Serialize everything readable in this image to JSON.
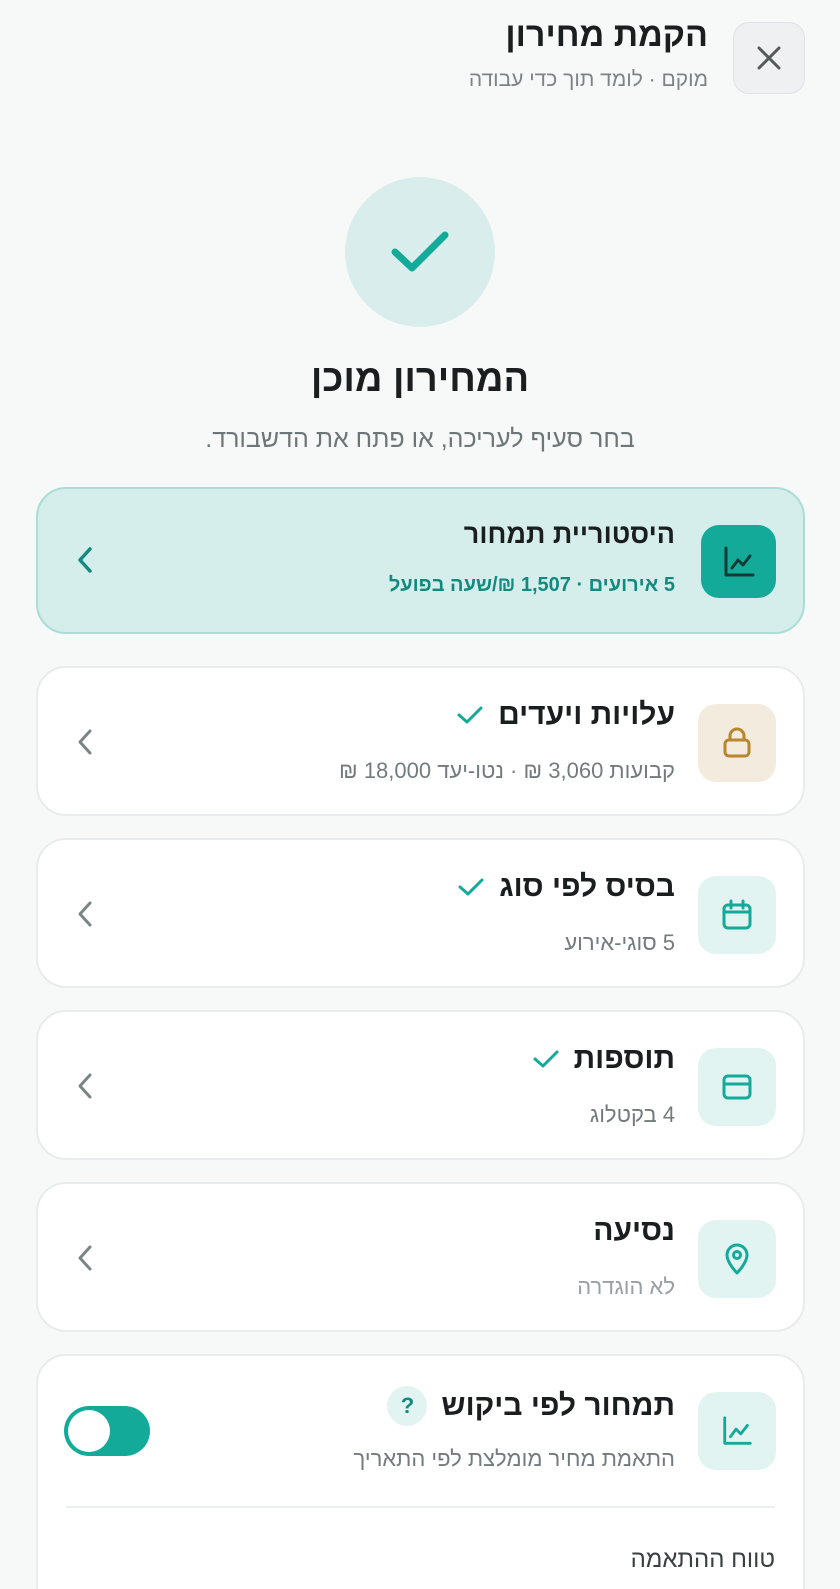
{
  "header": {
    "title": "הקמת מחירון",
    "subtitle": "מוקם · לומד תוך כדי עבודה",
    "close_icon": "close-icon"
  },
  "success": {
    "icon": "check-icon",
    "title": "המחירון מוכן",
    "subtitle": "בחר סעיף לעריכה, או פתח את הדשבורד."
  },
  "sections": [
    {
      "title": "היסטוריית תמחור",
      "subtitle": "5 אירועים · 1,507 ₪/שעה בפועל",
      "icon": "chart-icon",
      "active": true,
      "done": false
    },
    {
      "title": "עלויות ויעדים",
      "subtitle": "קבועות 3,060 ₪ · נטו-יעד 18,000 ₪",
      "icon": "lock-icon",
      "active": false,
      "done": true
    },
    {
      "title": "בסיס לפי סוג",
      "subtitle": "5 סוגי-אירוע",
      "icon": "calendar-icon",
      "active": false,
      "done": true
    },
    {
      "title": "תוספות",
      "subtitle": "4 בקטלוג",
      "icon": "card-icon",
      "active": false,
      "done": true
    },
    {
      "title": "נסיעה",
      "subtitle": "לא הוגדרה",
      "icon": "location-pin-icon",
      "active": false,
      "done": false
    }
  ],
  "demand_pricing": {
    "title": "תמחור לפי ביקוש",
    "help": "?",
    "subtitle": "התאמת מחיר מומלצת לפי התאריך",
    "icon": "chart-icon",
    "enabled": true,
    "range_label": "טווח ההתאמה"
  },
  "colors": {
    "accent": "#14aa9a",
    "accent_dark": "#138a7e",
    "active_bg": "#d5eeeb",
    "gold": "#b8862e"
  }
}
